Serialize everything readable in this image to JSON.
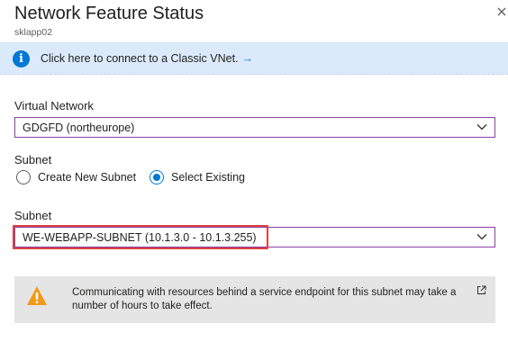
{
  "header": {
    "title": "Network Feature Status",
    "subtitle": "sklapp02"
  },
  "info_bar": {
    "text": "Click here to connect to a Classic VNet.",
    "arrow": "→",
    "icon": "info-icon",
    "accent": "#0078d4"
  },
  "virtual_network": {
    "label": "Virtual Network",
    "value": "GDGFD (northeurope)"
  },
  "subnet_mode": {
    "label": "Subnet",
    "options": [
      {
        "label": "Create New Subnet",
        "checked": false
      },
      {
        "label": "Select Existing",
        "checked": true
      }
    ]
  },
  "subnet": {
    "label": "Subnet",
    "value": "WE-WEBAPP-SUBNET (10.1.3.0 - 10.1.3.255)"
  },
  "warning": {
    "text": "Communicating with resources behind a service endpoint for this subnet may take a number of hours to take effect.",
    "icon": "warning-icon",
    "color": "#f29a18"
  },
  "colors": {
    "select_border": "#8a3ea6",
    "highlight": "#e04040",
    "info_bg": "#dbeafb"
  }
}
